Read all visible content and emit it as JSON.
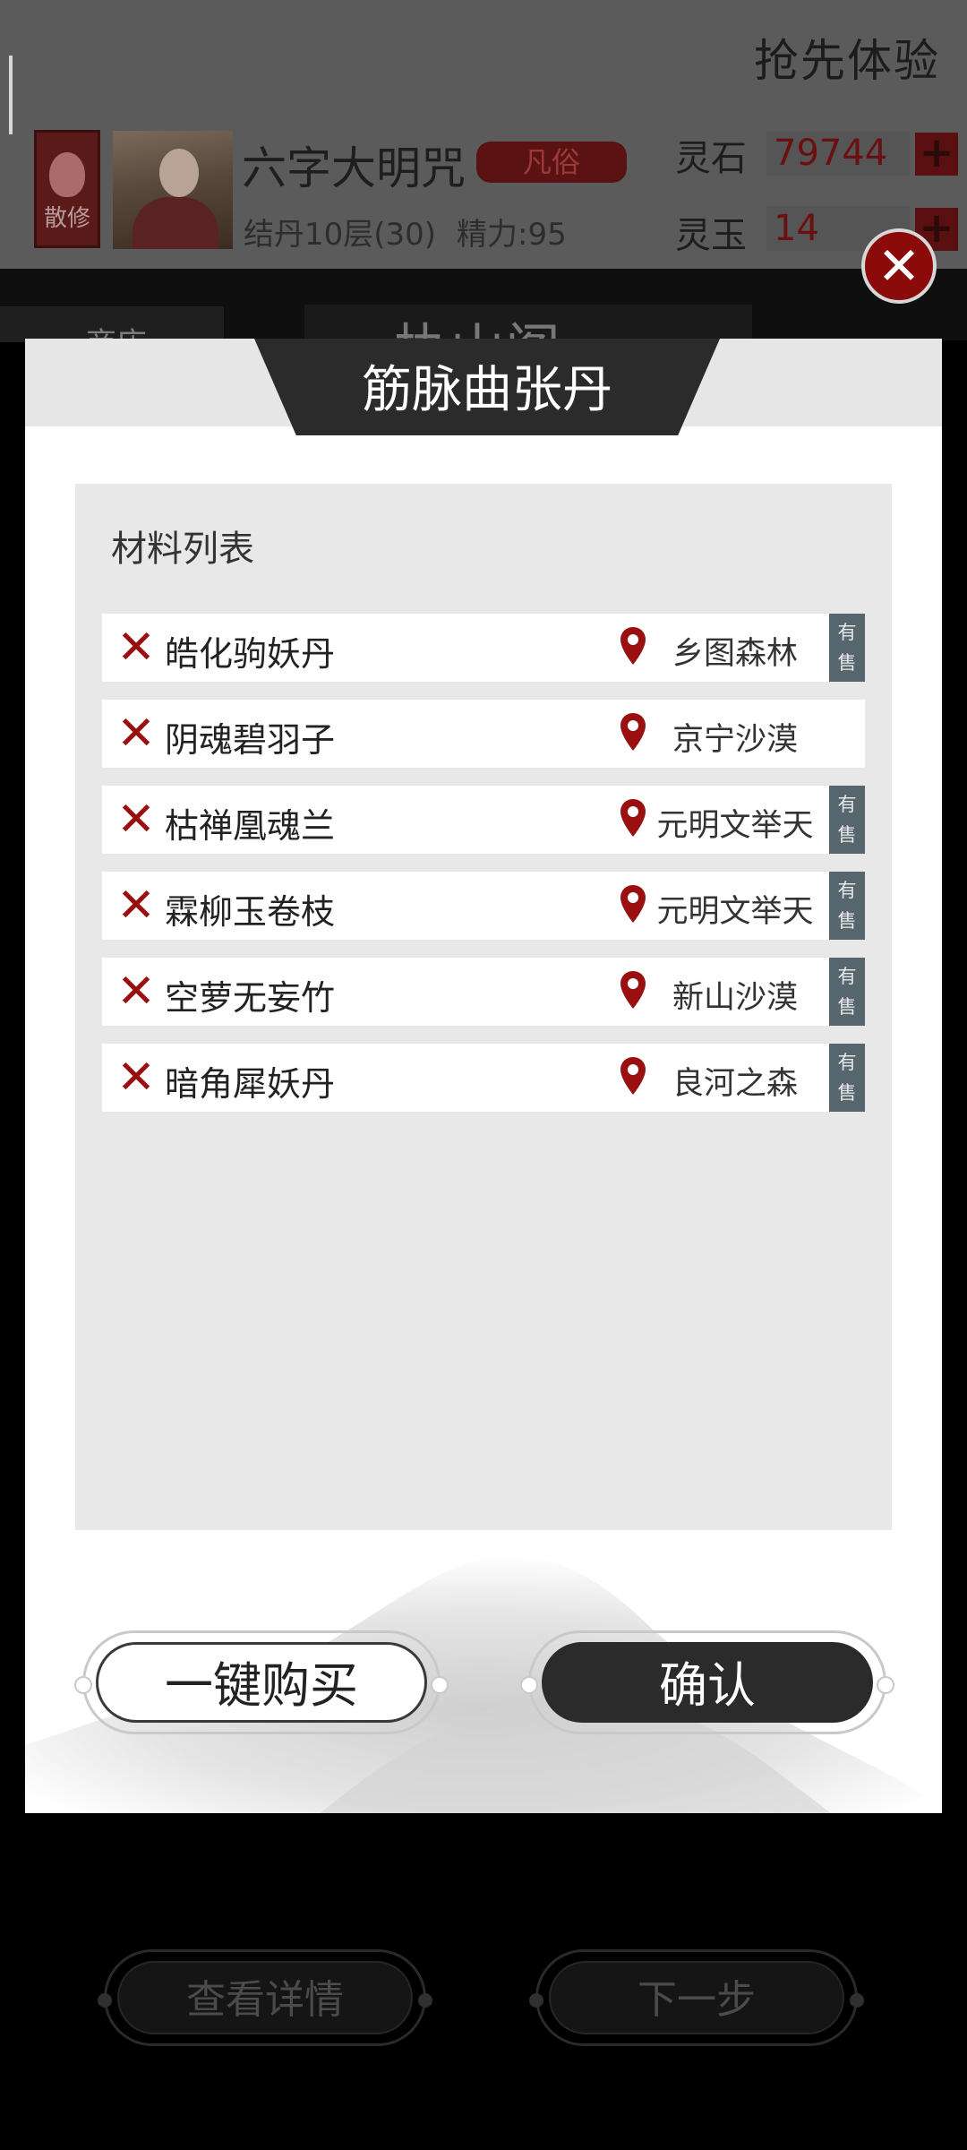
{
  "header": {
    "early_access": "抢先体验",
    "sect_badge": "散修",
    "player_name": "六字大明咒",
    "rank": "凡俗",
    "cultivation": "结丹10层(30)",
    "energy": "精力:95",
    "spirit_stone": {
      "label": "灵石",
      "value": "79744"
    },
    "spirit_jade": {
      "label": "灵玉",
      "value": "14"
    }
  },
  "background": {
    "back_label": "商店",
    "shop_title": "执山阁",
    "buttons": {
      "details": "查看详情",
      "next": "下一步"
    }
  },
  "dialog": {
    "title": "筋脉曲张丹",
    "materials_heading": "材料列表",
    "sale_tag": "有售",
    "materials": [
      {
        "name": "皓化驹妖丹",
        "location": "乡图森林",
        "on_sale": true
      },
      {
        "name": "阴魂碧羽子",
        "location": "京宁沙漠",
        "on_sale": false
      },
      {
        "name": "枯禅凰魂兰",
        "location": "元明文举天",
        "on_sale": true
      },
      {
        "name": "霖柳玉卷枝",
        "location": "元明文举天",
        "on_sale": true
      },
      {
        "name": "空萝无妄竹",
        "location": "新山沙漠",
        "on_sale": true
      },
      {
        "name": "暗角犀妖丹",
        "location": "良河之森",
        "on_sale": true
      }
    ],
    "buttons": {
      "buy_all": "一键购买",
      "confirm": "确认"
    }
  },
  "colors": {
    "accent_red": "#9a0f0f",
    "dark": "#2b2b2b",
    "sale_tag": "#56666f",
    "panel": "#e8e8e8"
  }
}
